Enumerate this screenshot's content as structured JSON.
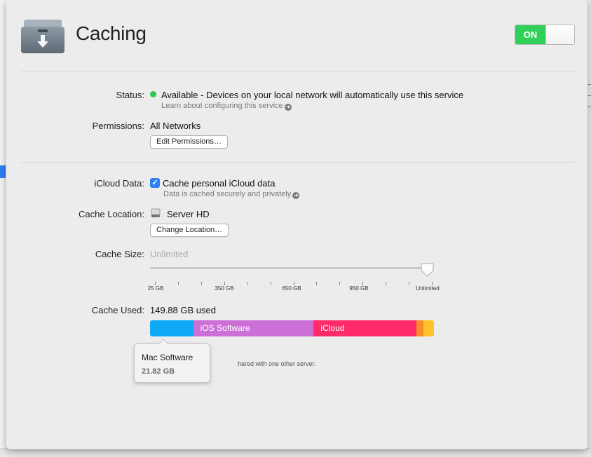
{
  "header": {
    "title": "Caching",
    "icon": "caching-service-icon",
    "toggle_on_label": "ON"
  },
  "status": {
    "label": "Status:",
    "value": "Available - Devices on your local network will automatically use this service",
    "indicator_color": "#2cc84d",
    "help_link": "Learn about configuring this service"
  },
  "permissions": {
    "label": "Permissions:",
    "value": "All Networks",
    "edit_button": "Edit Permissions…"
  },
  "icloud": {
    "label": "iCloud Data:",
    "checkbox_label": "Cache personal iCloud data",
    "checked": true,
    "help_link": "Data is cached securely and privately"
  },
  "cache_location": {
    "label": "Cache Location:",
    "value": "Server HD",
    "change_button": "Change Location…"
  },
  "cache_size": {
    "label": "Cache Size:",
    "value": "Unlimited",
    "slider_ticks": [
      "25 GB",
      "350 GB",
      "650 GB",
      "950 GB",
      "Unlimited"
    ],
    "slider_level": 1.0
  },
  "cache_used": {
    "label": "Cache Used:",
    "value": "149.88 GB used",
    "segments": [
      {
        "name": "",
        "color": "#0eaaf5",
        "fraction": 0.153
      },
      {
        "name": "iOS Software",
        "color": "#cc70d8",
        "fraction": 0.425
      },
      {
        "name": "iCloud",
        "color": "#ff2a6a",
        "fraction": 0.363
      },
      {
        "name": "",
        "color": "#ff8c2a",
        "fraction": 0.022
      },
      {
        "name": "",
        "color": "#ffc22a",
        "fraction": 0.037
      }
    ],
    "info_text": "hared with one other server."
  },
  "tooltip": {
    "title": "Mac Software",
    "size": "21.82 GB"
  }
}
